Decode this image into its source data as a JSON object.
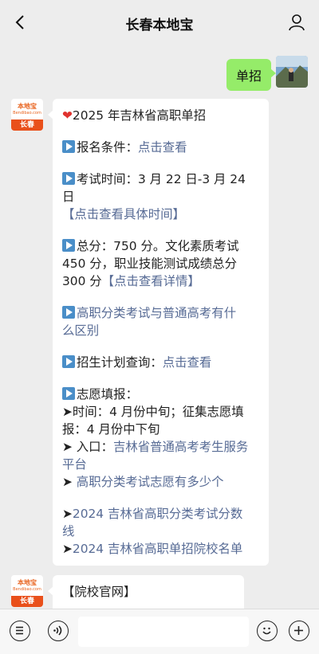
{
  "header": {
    "title": "长春本地宝"
  },
  "my_message": {
    "text": "单招"
  },
  "bot": {
    "brand": "本地宝",
    "brand_sub": "Bendibao.com",
    "city": "长春"
  },
  "post": {
    "heading": "2025 年吉林省高职单招",
    "reg_label": "报名条件：",
    "reg_link": "点击查看",
    "exam_label": "考试时间：3 月 22 日-3 月 24 日",
    "exam_link": "【点击查看具体时间】",
    "score_line1": "总分：750 分。文化素质考试",
    "score_line2": "450 分，职业技能测试成绩总分",
    "score_line3_pre": "300 分",
    "score_link": "【点击查看详情】",
    "diff_line1": "高职分类考试与普通高考有什",
    "diff_line2": "么区别",
    "plan_label": "招生计划查询：",
    "plan_link": "点击查看",
    "vol_title": "志愿填报：",
    "vol_time1": "➤时间：4 月份中旬；征集志愿填",
    "vol_time2": "报：4 月份中下旬",
    "vol_entry_label": "➤ 入口：",
    "vol_entry_link1": "吉林省普通高考考生服务",
    "vol_entry_link2": "平台",
    "vol_count_prefix": "➤ ",
    "vol_count_link": "高职分类考试志愿有多少个",
    "score2024_prefix": "➤",
    "score2024_link1": "2024 吉林省高职分类考试分数",
    "score2024_link2": "线",
    "list2024_prefix": "➤",
    "list2024_link": "2024 吉林省高职单招院校名单"
  },
  "second_post": {
    "text": "【院校官网】"
  },
  "icons": [
    "back-icon",
    "user-icon",
    "heart-icon",
    "play-icon",
    "menu-list-icon",
    "voice-icon",
    "emoji-icon",
    "add-icon"
  ],
  "colors": {
    "link": "#576b95",
    "green_bubble": "#95ec69",
    "brand_orange": "#e9501b",
    "background": "#ededed"
  }
}
